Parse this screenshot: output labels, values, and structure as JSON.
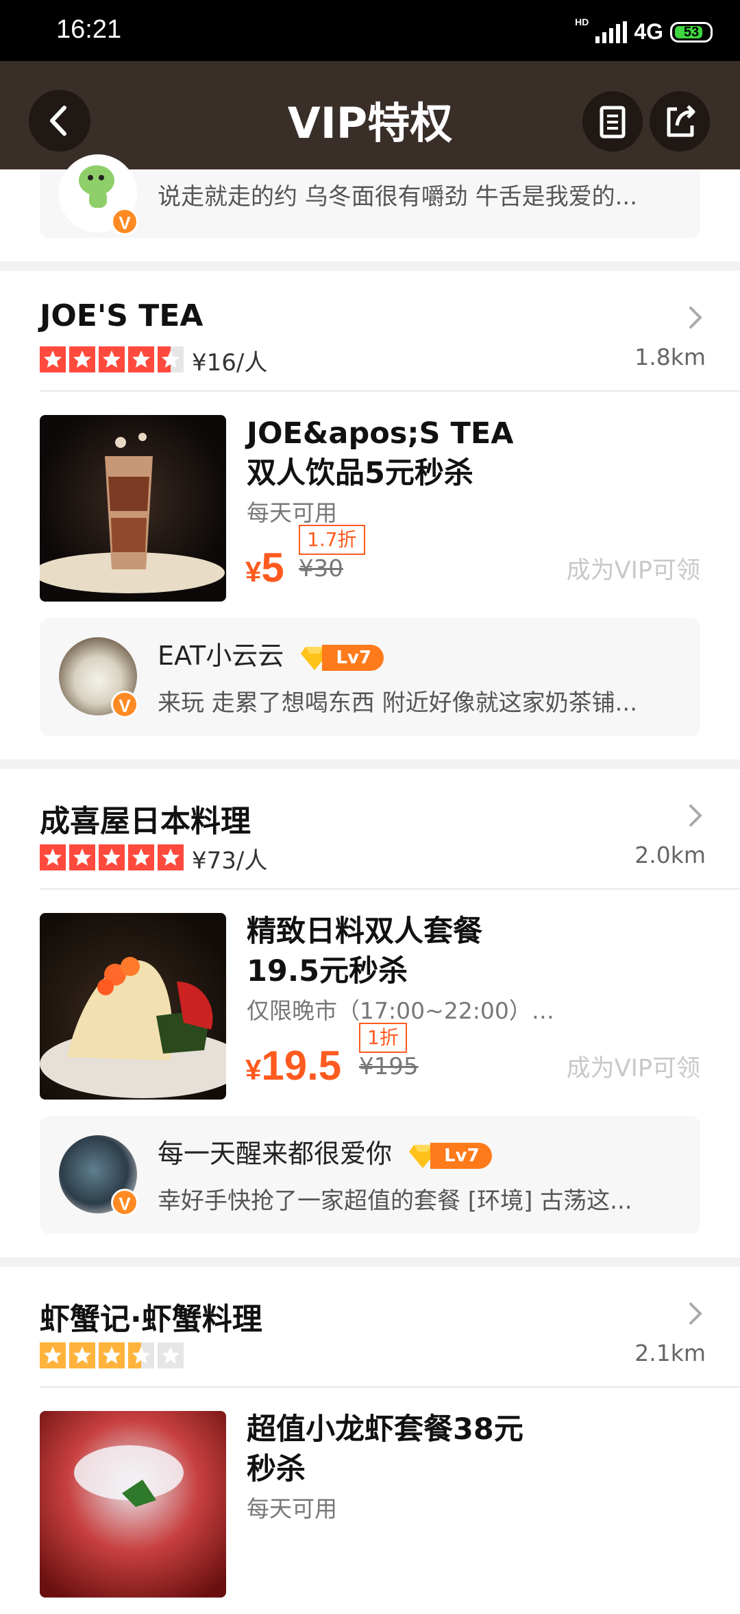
{
  "status_bar": {
    "time": "16:21",
    "hd": "HD",
    "network": "4G",
    "battery": "53"
  },
  "nav": {
    "title": "VIP特权"
  },
  "top_review": {
    "text": "说走就走的约 乌冬面很有嚼劲 牛舌是我爱的..."
  },
  "shops": [
    {
      "name": "JOE'S TEA",
      "price_per_person": "¥16/人",
      "distance": "1.8km",
      "rating": 4.5,
      "deal": {
        "title": "JOE&apos;S TEA双人饮品5元秒杀",
        "subtitle": "每天可用",
        "price_symbol": "¥",
        "price": "5",
        "discount": "1.7折",
        "original_price": "¥30",
        "claim": "成为VIP可领"
      },
      "review": {
        "name": "EAT小云云",
        "level": "Lv7",
        "text": "来玩 走累了想喝东西 附近好像就这家奶茶铺..."
      }
    },
    {
      "name": "成喜屋日本料理",
      "price_per_person": "¥73/人",
      "distance": "2.0km",
      "rating": 5,
      "deal": {
        "title": "精致日料双人套餐19.5元秒杀",
        "subtitle": "仅限晚市（17:00~22:00）使...",
        "price_symbol": "¥",
        "price": "19.5",
        "discount": "1折",
        "original_price": "¥195",
        "claim": "成为VIP可领"
      },
      "review": {
        "name": "每一天醒来都很爱你",
        "level": "Lv7",
        "text": "幸好手快抢了一家超值的套餐 [环境] 古荡这..."
      }
    },
    {
      "name": "虾蟹记·虾蟹料理",
      "price_per_person": "",
      "distance": "2.1km",
      "rating": 3.5,
      "deal": {
        "title": "超值小龙虾套餐38元秒杀",
        "subtitle": "每天可用"
      }
    }
  ],
  "icons": {
    "back": "chevron-left-icon",
    "list": "list-icon",
    "share": "share-icon",
    "arrow": "chevron-right-icon",
    "vip_badge": "v-badge-icon",
    "level_gem": "diamond-icon"
  },
  "colors": {
    "nav_bg": "#3a2e28",
    "accent": "#ff5a1f",
    "star_red": "#ff4a3d",
    "star_orange": "#ffb33d",
    "level_badge": "#ff7a1a"
  }
}
